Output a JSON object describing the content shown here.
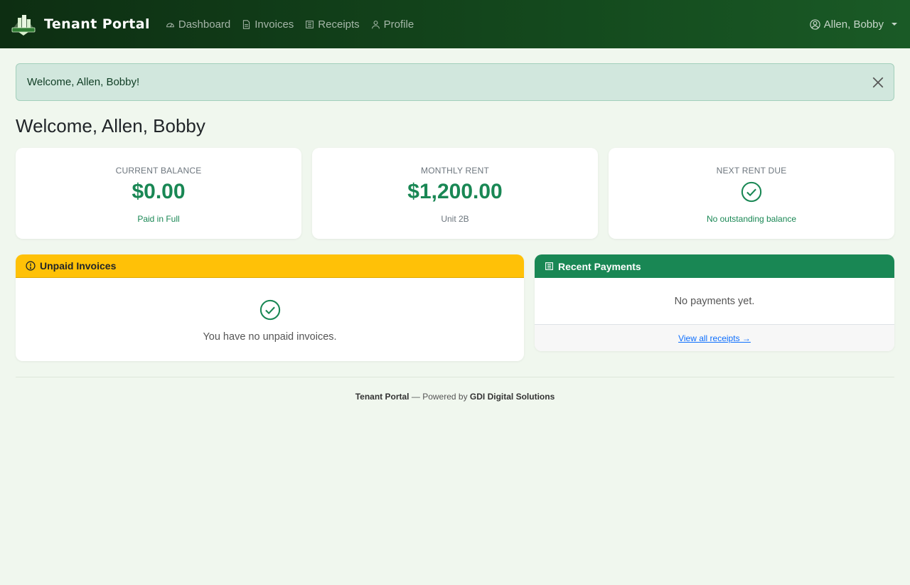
{
  "nav": {
    "brand": "Tenant Portal",
    "items": [
      {
        "label": "Dashboard",
        "icon": "speedometer-icon"
      },
      {
        "label": "Invoices",
        "icon": "document-icon"
      },
      {
        "label": "Receipts",
        "icon": "receipt-icon"
      },
      {
        "label": "Profile",
        "icon": "person-icon"
      }
    ],
    "user": "Allen, Bobby"
  },
  "alert": {
    "message": "Welcome, Allen, Bobby!"
  },
  "page_title": "Welcome, Allen, Bobby",
  "stats": [
    {
      "label": "CURRENT BALANCE",
      "value": "$0.00",
      "sub": "Paid in Full"
    },
    {
      "label": "MONTHLY RENT",
      "value": "$1,200.00",
      "sub": "Unit 2B"
    },
    {
      "label": "NEXT RENT DUE",
      "icon": "check-circle-icon",
      "sub": "No outstanding balance"
    }
  ],
  "unpaid": {
    "title": "Unpaid Invoices",
    "message": "You have no unpaid invoices."
  },
  "payments": {
    "title": "Recent Payments",
    "message": "No payments yet.",
    "link": "View all receipts →"
  },
  "footer": {
    "brand": "Tenant Portal",
    "middle": " — Powered by ",
    "company": "GDI Digital Solutions"
  },
  "colors": {
    "primary": "#198754",
    "warning": "#ffc107",
    "nav_dark": "#0d2e12",
    "page_bg": "#f0f7ee"
  }
}
